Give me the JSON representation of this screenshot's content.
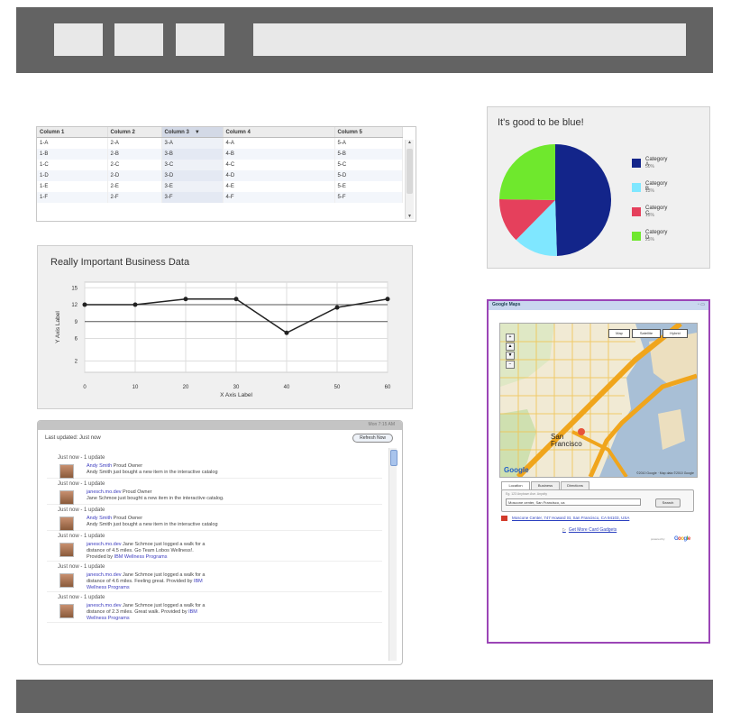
{
  "table": {
    "columns": [
      "Column 1",
      "Column 2",
      "Column 3",
      "Column 4",
      "Column 5"
    ],
    "sorted_column": 2,
    "sort_indicator": "▼",
    "rows": [
      [
        "1-A",
        "2-A",
        "3-A",
        "4-A",
        "5-A"
      ],
      [
        "1-B",
        "2-B",
        "3-B",
        "4-B",
        "5-B"
      ],
      [
        "1-C",
        "2-C",
        "3-C",
        "4-C",
        "5-C"
      ],
      [
        "1-D",
        "2-D",
        "3-D",
        "4-D",
        "5-D"
      ],
      [
        "1-E",
        "2-E",
        "3-E",
        "4-E",
        "5-E"
      ],
      [
        "1-F",
        "2-F",
        "3-F",
        "4-F",
        "5-F"
      ]
    ]
  },
  "line_chart": {
    "title": "Really Important Business Data"
  },
  "pie_chart": {
    "title": "It's good to be blue!"
  },
  "chart_data": [
    {
      "type": "line",
      "title": "Really Important Business Data",
      "xlabel": "X Axis Label",
      "ylabel": "Y Axis Label",
      "x": [
        0,
        10,
        20,
        30,
        40,
        50,
        60
      ],
      "series": [
        {
          "values": [
            12,
            12,
            13,
            13,
            7,
            11.5,
            13
          ]
        }
      ],
      "xlim": [
        0,
        60
      ],
      "ylim": [
        0,
        16
      ],
      "xticks": [
        0,
        10,
        20,
        30,
        40,
        50,
        60
      ],
      "yticks": [
        2,
        6,
        9,
        12,
        15
      ],
      "grid": true,
      "colors": {
        "line": "#222222"
      }
    },
    {
      "type": "pie",
      "title": "It's good to be blue!",
      "categories": [
        "Category A",
        "Category B",
        "Category C",
        "Category D"
      ],
      "values": [
        50,
        13,
        13,
        25
      ],
      "labels": [
        "50%",
        "13%",
        "13%",
        "25%"
      ],
      "colors": [
        "#13258a",
        "#7fe7ff",
        "#e5405c",
        "#6fe82d"
      ],
      "legend": "right"
    }
  ],
  "feed": {
    "header_meta": "Mon 7:15 AM",
    "last_updated": "Last updated: Just now",
    "refresh_label": "Refresh Now",
    "entries": [
      {
        "when": "Just now - 1 update",
        "user": "Andy Smith",
        "tail": " Proud Owner",
        "line2": "Andy Smith just bought a new item in the interactive catalog"
      },
      {
        "when": "Just now - 1 update",
        "user": "janesch.mo.dev",
        "tail": " Proud Owner",
        "line2": "Jane Schmoe just bought a new item in the interactive catalog."
      },
      {
        "when": "Just now - 1 update",
        "user": "Andy Smith",
        "tail": " Proud Owner",
        "line2": "Andy Smith just bought a new item in the interactive catalog"
      },
      {
        "when": "Just now - 1 update",
        "user": "janesch.mo.dev",
        "tail": " Jane Schmoe just logged a walk for a",
        "line2": "distance of 4.5 miles. Go Team Lobos Wellness!.",
        "line3_pre": "Provided by ",
        "line3_link": "IBM Wellness Programs"
      },
      {
        "when": "Just now - 1 update",
        "user": "janesch.mo.dev",
        "tail": " Jane Schmoe just logged a walk for a",
        "line2": "distance of 4.6 miles. Feeling great. Provided by ",
        "line2_link": "IBM",
        "line3_pre": "",
        "line3_link": "Wellness Programs"
      },
      {
        "when": "Just now - 1 update",
        "user": "janesch.mo.dev",
        "tail": " Jane Schmoe just logged a walk for a",
        "line2": "distance of 2.3 miles. Great walk. Provided by ",
        "line2_link": "IBM",
        "line3_pre": "",
        "line3_link": "Wellness Programs"
      }
    ]
  },
  "map": {
    "title": "Google Maps",
    "controls": "▫ ▭",
    "types": [
      "Map",
      "Satellite",
      "Hybrid"
    ],
    "city_line1": "San",
    "city_line2": "Francisco",
    "google": "Google",
    "copyright": "©2010 Google · Map data ©2010 Google",
    "tabs": [
      "Location",
      "Business",
      "Directions"
    ],
    "search_hint": "Eg. 123 Anytown Ave. Anycity",
    "search_value": "Moscone center, San Francisco, ca",
    "search_button": "Search",
    "result_address": "Moscone Center, 747 Howard St, San Francisco, CA 94103, USA",
    "directions_mark": "▷",
    "directions_link": "Get More Card Gadgets",
    "powered_by": "powered by",
    "brand": "Google"
  }
}
